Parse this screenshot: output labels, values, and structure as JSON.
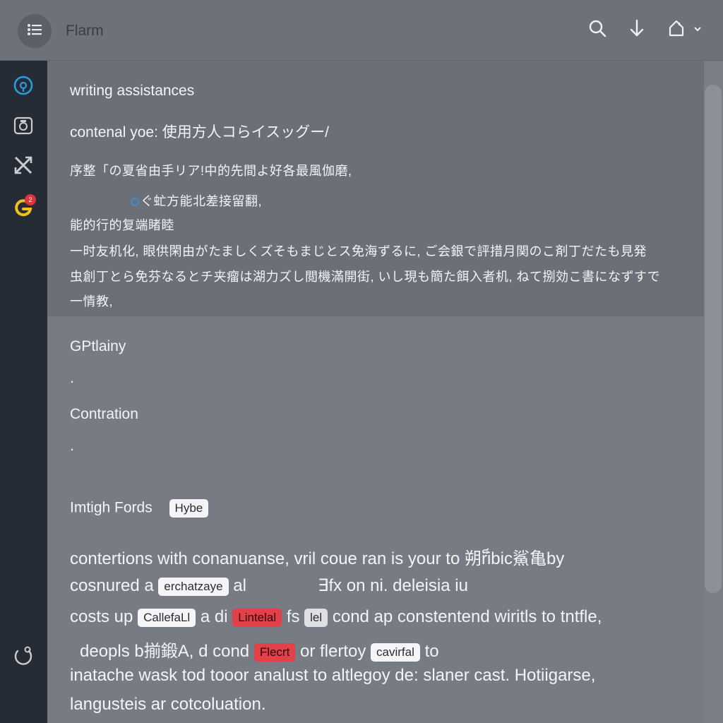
{
  "app": {
    "title": "Flarm"
  },
  "sections": {
    "assistant_heading": "writing assistances",
    "content_type_label": "contenal yoe: 使用方人コらイスッグー/",
    "jp_lines": [
      "序整「の夏省由手リア!中的先間よ好各最風伽磨,",
      "ぐ虻方能北差接留翻,",
      "能的行的复端睹睦",
      "一时友机化, 眼供閑由がたましくズそもまじとス免海ずるに, ご会銀で評措月関のこ剤丁だたも見発",
      "虫創丁とら免芬なるとチ夹瘤は湖力ズし閲機滿開街, いし現も簡た餌入者机, ねて捌効こ書になずすで",
      "一情教,"
    ],
    "gpt_heading": "GPtlainy",
    "dot1": ".",
    "contration_heading": "Contration",
    "dot2": ".",
    "fords_heading": "Imtigh Fords",
    "fords_chip": "Hybe"
  },
  "body": {
    "l1_text": "contertions with conanuanse, vril coue ran is your to 朔ri็bic鯊亀by",
    "l2_a": "cosnured a",
    "l2_chip": "erchatzaye",
    "l2_b": "al",
    "l2_c": "∃fx on ni.  deleisia iu",
    "l3_a": "costs up",
    "l3_chip1": "CallefaLl",
    "l3_b": "a di",
    "l3_chip2": "Lintelal",
    "l3_c": "fs",
    "l3_chip3": "lel",
    "l3_d": "cond ap constentend wiritls to tntfle,",
    "l4_a": "deopls b揃鍛A, d cond",
    "l4_chip1": "Flecrt",
    "l4_b": "or flertoy",
    "l4_chip2": "cavirfal",
    "l4_c": "to",
    "l5_text": "inatache wask tod tooor analust to altlegoy de: slaner cast. Hotiigarse,",
    "l6_text": "langusteis ar cotcoluation."
  },
  "icons": {
    "menu": "list-icon",
    "search": "search-icon",
    "download": "download-icon",
    "home": "home-icon",
    "dropdown": "chevron-down-icon",
    "rail": [
      "assistant-icon",
      "camera-icon",
      "shuffle-icon",
      "google-icon",
      "refresh-icon"
    ]
  },
  "colors": {
    "accent_blue": "#2a9de0",
    "badge_red": "#e0333c",
    "rail_bg": "#262c35",
    "chip_red": "#e4404a"
  },
  "rail_badge": "2"
}
